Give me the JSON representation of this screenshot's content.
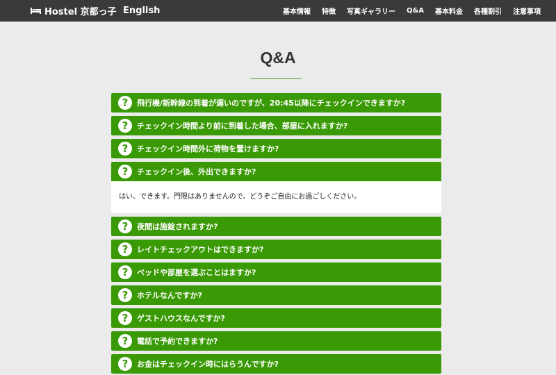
{
  "nav": {
    "brand": "Hostel 京都っ子",
    "language": "English",
    "links": [
      "基本情報",
      "特徴",
      "写真ギャラリー",
      "Q&A",
      "基本料金",
      "各種割引",
      "注意事項"
    ]
  },
  "page": {
    "title": "Q&A"
  },
  "faq": {
    "items": [
      {
        "question": "飛行機/新幹線の到着が遅いのですが、20:45以降にチェックインできますか?"
      },
      {
        "question": "チェックイン時間より前に到着した場合、部屋に入れますか?"
      },
      {
        "question": "チェックイン時間外に荷物を置けますか?"
      },
      {
        "question": "チェックイン後、外出できますか?",
        "answer": "はい、できます。門限はありませんので、どうぞご自由にお過ごしください。"
      },
      {
        "question": "夜間は施錠されますか?"
      },
      {
        "question": "レイトチェックアウトはできますか?"
      },
      {
        "question": "ベッドや部屋を選ぶことはますか?"
      },
      {
        "question": "ホテルなんですか?"
      },
      {
        "question": "ゲストハウスなんですか?"
      },
      {
        "question": "電話で予約できますか?"
      },
      {
        "question": "お金はチェックイン時にはらうんですか?"
      }
    ]
  },
  "colors": {
    "nav_bg": "#3a3a3a",
    "accent_green": "#3a9a05",
    "page_bg": "#ebebeb"
  },
  "icons": {
    "brand": "bed-icon",
    "question": "question-circle-icon"
  }
}
